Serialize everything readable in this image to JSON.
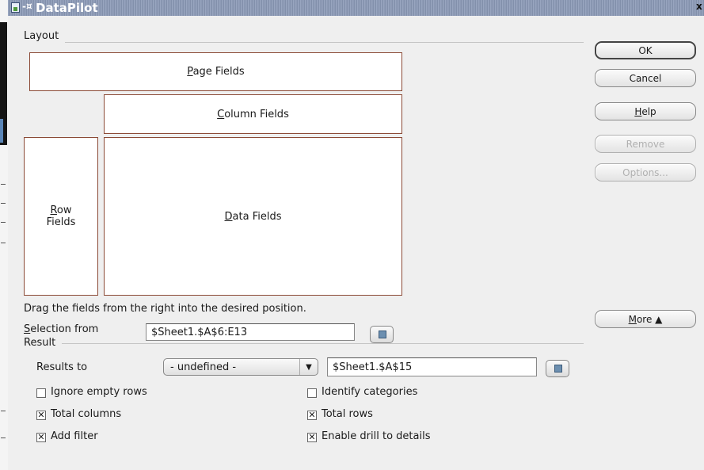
{
  "window": {
    "title": "DataPilot"
  },
  "layout": {
    "section_label": "Layout",
    "page_fields": "Page Fields",
    "column_fields": "Column Fields",
    "row_fields_line1": "Row",
    "row_fields_line2": "Fields",
    "data_fields": "Data Fields",
    "hint": "Drag the fields from the right into the desired position."
  },
  "selection": {
    "label": "Selection from",
    "value": "$Sheet1.$A$6:E13"
  },
  "result": {
    "section_label": "Result",
    "results_to_label": "Results to",
    "results_to_selected": "- undefined -",
    "results_to_value": "$Sheet1.$A$15"
  },
  "options": {
    "ignore_empty_rows": {
      "label": "Ignore empty rows",
      "checked": false
    },
    "identify_categories": {
      "label": "Identify categories",
      "checked": false
    },
    "total_columns": {
      "label": "Total columns",
      "checked": true
    },
    "total_rows": {
      "label": "Total rows",
      "checked": true
    },
    "add_filter": {
      "label": "Add filter",
      "checked": true
    },
    "enable_drill": {
      "label": "Enable drill to details",
      "checked": true
    }
  },
  "buttons": {
    "ok": "OK",
    "cancel": "Cancel",
    "help": "Help",
    "remove": "Remove",
    "options": "Options...",
    "more": "More"
  }
}
